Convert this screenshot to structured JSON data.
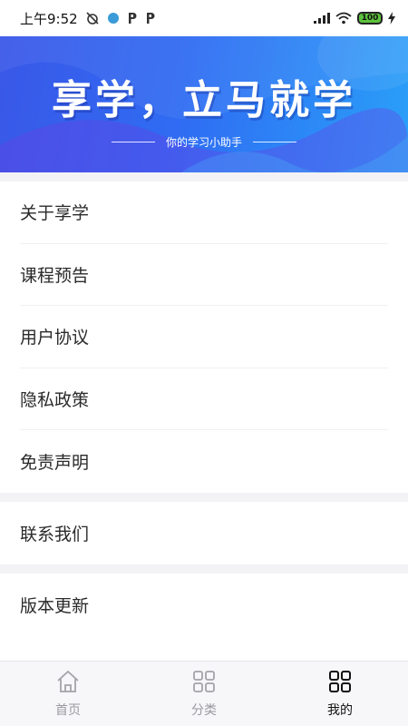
{
  "status_bar": {
    "time": "上午9:52",
    "battery": "100"
  },
  "banner": {
    "title": "享学，立马就学",
    "subtitle": "你的学习小助手"
  },
  "menu_group_1": [
    {
      "label": "关于享学"
    },
    {
      "label": "课程预告"
    },
    {
      "label": "用户协议"
    },
    {
      "label": "隐私政策"
    },
    {
      "label": "免责声明"
    }
  ],
  "menu_group_2": [
    {
      "label": "联系我们"
    }
  ],
  "menu_group_3": [
    {
      "label": "版本更新"
    }
  ],
  "tabbar": {
    "tabs": [
      {
        "label": "首页",
        "icon": "home-icon",
        "active": false
      },
      {
        "label": "分类",
        "icon": "grid-icon",
        "active": false
      },
      {
        "label": "我的",
        "icon": "grid-icon",
        "active": true
      }
    ]
  },
  "colors": {
    "banner_start": "#3a57e8",
    "banner_end": "#2aa0f8",
    "background": "#f3f3f5",
    "tab_active": "#111111",
    "tab_inactive": "#9a9aa0"
  }
}
